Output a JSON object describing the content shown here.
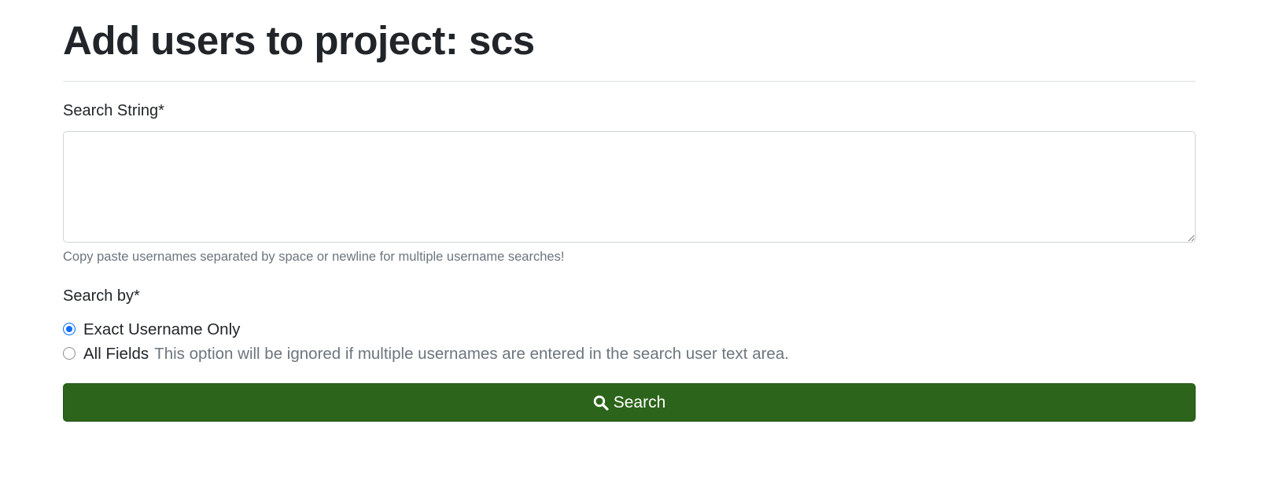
{
  "header": {
    "title": "Add users to project: scs"
  },
  "form": {
    "search_string_label": "Search String*",
    "search_string_value": "",
    "search_string_placeholder": "",
    "help_text": "Copy paste usernames separated by space or newline for multiple username searches!",
    "search_by_label": "Search by*",
    "options": [
      {
        "label": "Exact Username Only",
        "note": "",
        "selected": true
      },
      {
        "label": "All Fields",
        "note": "This option will be ignored if multiple usernames are entered in the search user text area.",
        "selected": false
      }
    ],
    "submit_label": "Search",
    "submit_icon": "search-icon"
  },
  "colors": {
    "submit_background": "#2c641b",
    "radio_accent": "#0d6efd",
    "muted_text": "#6c757d"
  }
}
